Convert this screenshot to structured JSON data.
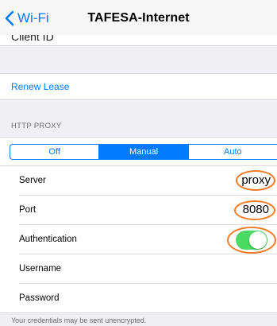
{
  "navbar": {
    "back_label": "Wi-Fi",
    "title": "TAFESA-Internet"
  },
  "clipped_row": {
    "label": "Client ID"
  },
  "renew_lease": {
    "label": "Renew Lease"
  },
  "http_proxy": {
    "header": "HTTP PROXY",
    "segments": [
      {
        "label": "Off",
        "selected": false
      },
      {
        "label": "Manual",
        "selected": true
      },
      {
        "label": "Auto",
        "selected": false
      }
    ]
  },
  "fields": {
    "server": {
      "label": "Server",
      "value": "proxy"
    },
    "port": {
      "label": "Port",
      "value": "8080"
    },
    "authentication": {
      "label": "Authentication",
      "enabled": true
    },
    "username": {
      "label": "Username",
      "value": ""
    },
    "password": {
      "label": "Password",
      "value": ""
    }
  },
  "footer": {
    "note": "Your credentials may be sent unencrypted."
  },
  "colors": {
    "accent": "#007aff",
    "toggle_on": "#4cd964",
    "highlight": "#f07c25",
    "background": "#efeff4"
  },
  "icons": {
    "back": "chevron-left-icon"
  }
}
